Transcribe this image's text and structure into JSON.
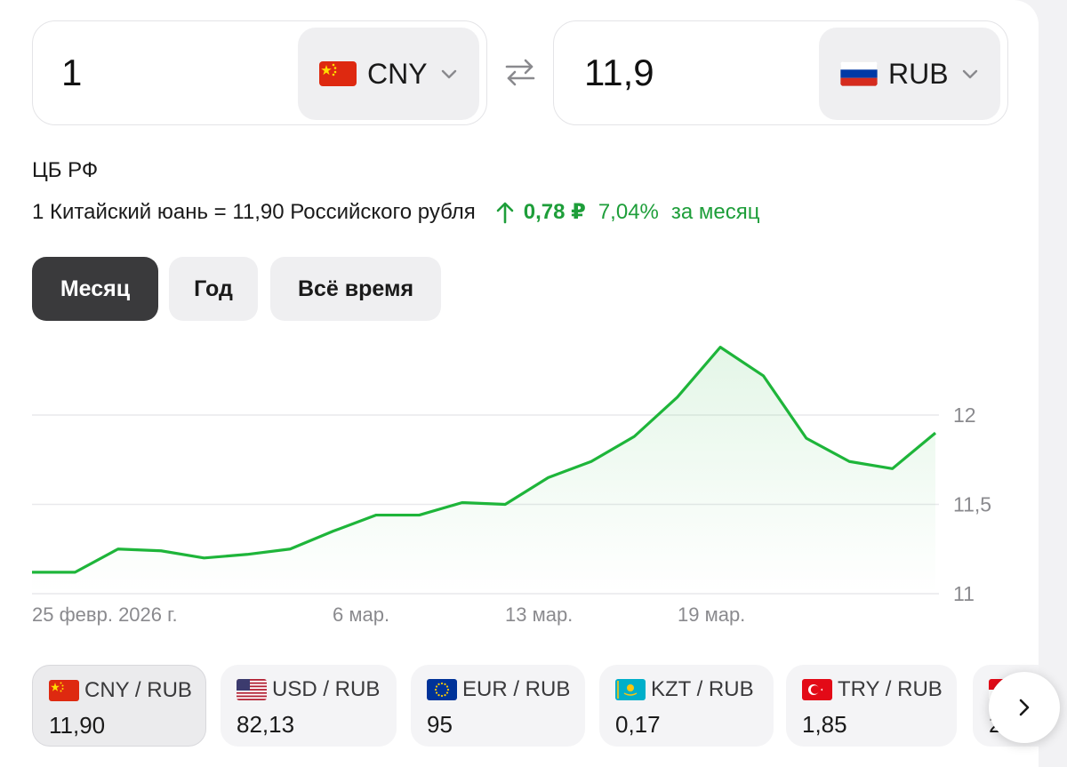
{
  "converter": {
    "from": {
      "amount": "1",
      "currency": "CNY",
      "flag": "china-flag-icon"
    },
    "to": {
      "amount": "11,9",
      "currency": "RUB",
      "flag": "russia-flag-icon"
    },
    "swap_icon": "swap-arrows-icon"
  },
  "summary": {
    "source": "ЦБ РФ",
    "rate_text": "1 Китайский юань = 11,90 Российского рубля",
    "delta": "0,78 ₽",
    "delta_percent": "7,04%",
    "period": "за месяц",
    "trend_color": "#1e9e3a"
  },
  "tabs": [
    {
      "label": "Месяц",
      "active": true
    },
    {
      "label": "Год",
      "active": false
    },
    {
      "label": "Всё время",
      "active": false
    }
  ],
  "chart_data": {
    "type": "line",
    "x": [
      "25 февр. 2026 г.",
      "26 февр.",
      "27 февр.",
      "28 февр.",
      "2 мар.",
      "3 мар.",
      "4 мар.",
      "5 мар.",
      "6 мар.",
      "7 мар.",
      "10 мар.",
      "11 мар.",
      "12 мар.",
      "13 мар.",
      "14 мар.",
      "17 мар.",
      "18 мар.",
      "19 мар.",
      "20 мар.",
      "21 мар.",
      "24 мар.",
      "25 мар.",
      "26 мар."
    ],
    "series": [
      {
        "values": [
          11.12,
          11.12,
          11.25,
          11.24,
          11.2,
          11.22,
          11.25,
          11.35,
          11.44,
          11.44,
          11.51,
          11.5,
          11.65,
          11.74,
          11.88,
          12.1,
          12.38,
          12.22,
          11.87,
          11.74,
          11.7,
          11.9
        ]
      }
    ],
    "x_tick_labels": [
      "25 февр. 2026 г.",
      "6 мар.",
      "13 мар.",
      "19 мар."
    ],
    "y_tick_labels": [
      "12",
      "11,5",
      "11"
    ],
    "ylim": [
      11,
      12.5
    ],
    "line_color": "#1eb53a",
    "grid": true
  },
  "pairs": [
    {
      "name": "CNY / RUB",
      "value": "11,90",
      "flag": "china-flag-icon",
      "active": true
    },
    {
      "name": "USD / RUB",
      "value": "82,13",
      "flag": "usa-flag-icon",
      "active": false
    },
    {
      "name": "EUR / RUB",
      "value": "95",
      "flag": "eu-flag-icon",
      "active": false
    },
    {
      "name": "KZT / RUB",
      "value": "0,17",
      "flag": "kazakhstan-flag-icon",
      "active": false
    },
    {
      "name": "TRY / RUB",
      "value": "1,85",
      "flag": "turkey-flag-icon",
      "active": false
    },
    {
      "name": "",
      "value": "2",
      "flag": "partial-flag-icon",
      "active": false
    }
  ],
  "next_icon": "chevron-right-icon"
}
